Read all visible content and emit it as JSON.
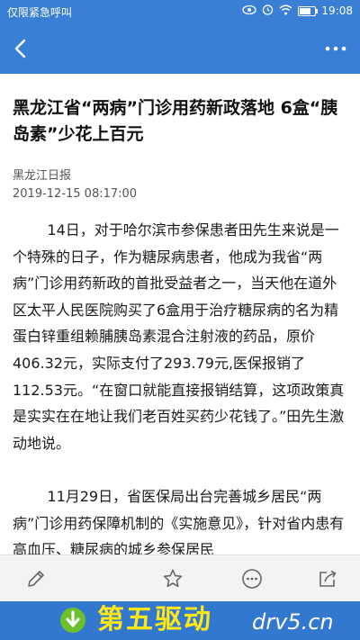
{
  "status_bar": {
    "carrier": "仅限紧急呼叫",
    "time": "19:08",
    "icons": [
      "eye-icon",
      "alarm-icon",
      "wifi-icon",
      "battery-icon"
    ]
  },
  "app_bar": {
    "back_icon": "chevron-left-icon",
    "more_icon": "more-dots-icon",
    "color": "#3a7fd6"
  },
  "article": {
    "title": "黑龙江省“两病”门诊用药新政落地 6盒“胰岛素”少花上百元",
    "source": "黑龙江日报",
    "date": "2019-12-15 08:17:00",
    "paragraph1": "14日，对于哈尔滨市参保患者田先生来说是一个特殊的日子，作为糖尿病患者，他成为我省“两病”门诊用药新政的首批受益者之一，当天他在道外区太平人民医院购买了6盒用于治疗糖尿病的名为精蛋白锌重组赖脯胰岛素混合注射液的药品，原价406.32元，实际支付了293.79元,医保报销了112.53元。“在窗口就能直接报销结算，这项政策真是实实在在地让我们老百姓买药少花钱了。”田先生激动地说。",
    "paragraph2": "11月29日，省医保局出台完善城乡居民“两病”门诊用药保障机制的《实施意见》，针对省内患有高血压、糖尿病的城乡参保居民"
  },
  "toolbar": {
    "icons": [
      "edit-icon",
      "star-icon",
      "more-icon",
      "share-icon"
    ]
  },
  "watermark": {
    "brand": "第五驱动",
    "url": "drv5.cn",
    "brand_color": "#ffe814"
  }
}
